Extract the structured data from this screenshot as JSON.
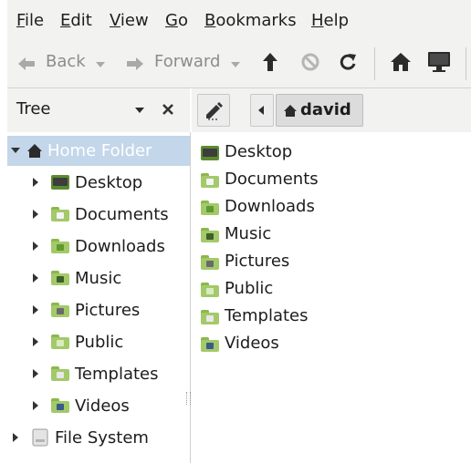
{
  "menubar": {
    "file": "File",
    "edit": "Edit",
    "view": "View",
    "go": "Go",
    "bookmarks": "Bookmarks",
    "help": "Help"
  },
  "toolbar": {
    "back": "Back",
    "forward": "Forward"
  },
  "sidepane": {
    "mode": "Tree"
  },
  "pathbar": {
    "current": "david"
  },
  "tree": {
    "root": "Home Folder",
    "children": [
      "Desktop",
      "Documents",
      "Downloads",
      "Music",
      "Pictures",
      "Public",
      "Templates",
      "Videos"
    ],
    "filesystem": "File System"
  },
  "files": [
    "Desktop",
    "Documents",
    "Downloads",
    "Music",
    "Pictures",
    "Public",
    "Templates",
    "Videos"
  ],
  "colors": {
    "selection": "#c3d6ea",
    "home_link": "#ffffff",
    "folder_green": "#8ab84b",
    "accent": "#3a6ea5"
  }
}
